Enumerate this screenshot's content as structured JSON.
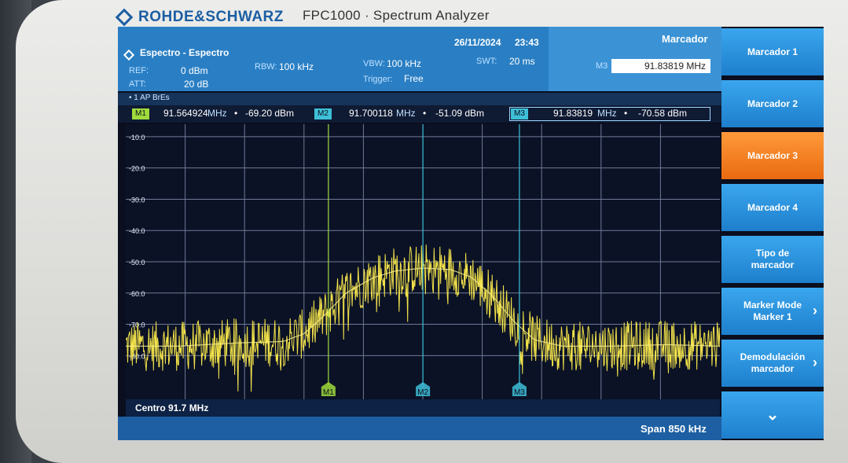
{
  "device": {
    "brand": "ROHDE&SCHWARZ",
    "model": "FPC1000 · Spectrum Analyzer"
  },
  "header": {
    "mode_title": "Espectro - Espectro",
    "date": "26/11/2024",
    "time": "23:43",
    "ref_label": "REF:",
    "ref_value": "0 dBm",
    "att_label": "ATT:",
    "att_value": "20 dB",
    "rbw_label": "RBW:",
    "rbw_value": "100 kHz",
    "vbw_label": "VBW:",
    "vbw_value": "100 kHz",
    "swt_label": "SWT:",
    "swt_value": "20 ms",
    "trigger_label": "Trigger:",
    "trigger_value": "Free",
    "panel_title": "Marcador",
    "m3_label": "M3",
    "m3_input": "91.83819 MHz"
  },
  "trace_info": "• 1 AP  BrEs",
  "markers": [
    {
      "id": "M1",
      "freq": "91.564924",
      "unit": "MHz",
      "sep": "•",
      "level": "-69.20 dBm",
      "color": "#9fdc3c"
    },
    {
      "id": "M2",
      "freq": "91.700118",
      "unit": "MHz",
      "sep": "•",
      "level": "-51.09 dBm",
      "color": "#3ec0d8"
    },
    {
      "id": "M3",
      "freq": "91.83819",
      "unit": "MHz",
      "sep": "•",
      "level": "-70.58 dBm",
      "color": "#3ec0d8"
    }
  ],
  "chart_data": {
    "type": "line",
    "title": "",
    "xlabel": "",
    "ylabel": "",
    "y_tick_labels": [
      "-10.0",
      "-20.0",
      "-30.0",
      "-40.0",
      "-50.0",
      "-60.0",
      "-70.0",
      "-80.0"
    ],
    "ylim": [
      -94,
      -6
    ],
    "xlim_mhz": [
      91.275,
      92.125
    ],
    "center_mhz": 91.7,
    "span_khz": 850,
    "grid": true,
    "trace_color": "#f2e24a",
    "series": [
      {
        "x_mhz": [
          91.275,
          91.35,
          91.43,
          91.5,
          91.53,
          91.56,
          91.59,
          91.63,
          91.66,
          91.7,
          91.74,
          91.77,
          91.8,
          91.83,
          91.86,
          91.9,
          91.97,
          92.05,
          92.125
        ],
        "y_dbm": [
          -77,
          -77,
          -76,
          -75.5,
          -73,
          -67,
          -60,
          -55,
          -53,
          -52,
          -52.5,
          -55,
          -61,
          -69,
          -75,
          -77,
          -77,
          -76.5,
          -77
        ]
      }
    ],
    "marker_positions": [
      {
        "label": "M1",
        "x_mhz": 91.564924,
        "color": "#9fdc3c"
      },
      {
        "label": "M2",
        "x_mhz": 91.700118,
        "color": "#3ec0d8"
      },
      {
        "label": "M3",
        "x_mhz": 91.83819,
        "color": "#3ec0d8"
      }
    ]
  },
  "footer": {
    "center": "Centro 91.7 MHz",
    "span": "Span 850 kHz"
  },
  "softkeys": [
    {
      "label": "Marcador 1",
      "active": false,
      "arrow": ""
    },
    {
      "label": "Marcador 2",
      "active": false,
      "arrow": ""
    },
    {
      "label": "Marcador 3",
      "active": true,
      "arrow": ""
    },
    {
      "label": "Marcador 4",
      "active": false,
      "arrow": ""
    },
    {
      "label": "Tipo de marcador",
      "active": false,
      "arrow": ""
    },
    {
      "label": "Marker Mode Marker 1",
      "active": false,
      "arrow": "›"
    },
    {
      "label": "Demodulación marcador",
      "active": false,
      "arrow": "›"
    },
    {
      "label": "",
      "active": false,
      "arrow": "⌄"
    }
  ],
  "colors": {
    "header_blue": "#2a7fc4",
    "active_orange": "#e96a10",
    "trace_yellow": "#f2e24a"
  }
}
